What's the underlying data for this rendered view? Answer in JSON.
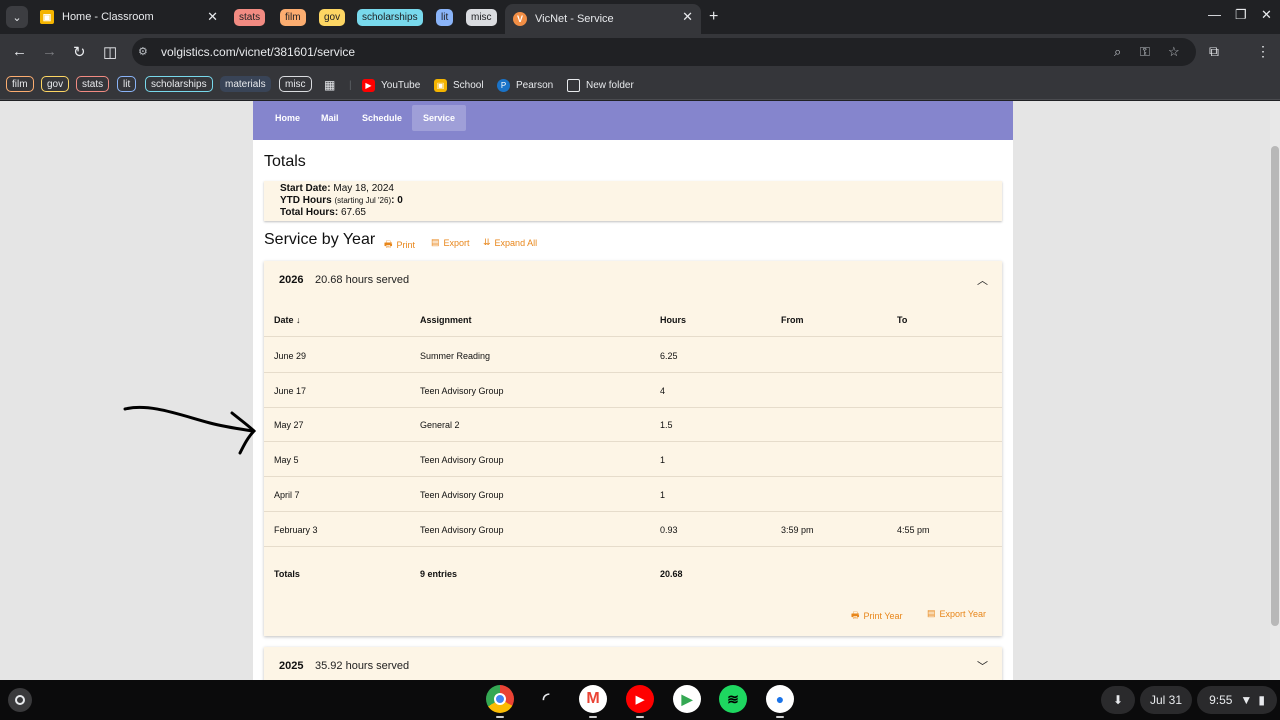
{
  "browser": {
    "tabs": [
      {
        "title": "Home - Classroom",
        "active": false
      },
      {
        "title": "VicNet - Service",
        "active": true
      }
    ],
    "tab_groups": [
      {
        "label": "stats",
        "color": "#f28b82"
      },
      {
        "label": "film",
        "color": "#fcad70"
      },
      {
        "label": "gov",
        "color": "#fdd663"
      },
      {
        "label": "scholarships",
        "color": "#78d9ec"
      },
      {
        "label": "lit",
        "color": "#8ab4f8"
      },
      {
        "label": "misc",
        "color": "#dadce0"
      }
    ],
    "url": "volgistics.com/vicnet/381601/service",
    "bookmark_groups": [
      {
        "label": "film",
        "color": "#fcad70"
      },
      {
        "label": "gov",
        "color": "#fdd663"
      },
      {
        "label": "stats",
        "color": "#f28b82"
      },
      {
        "label": "lit",
        "color": "#8ab4f8"
      },
      {
        "label": "scholarships",
        "color": "#78d9ec"
      },
      {
        "label": "materials",
        "color": "#aecbfa"
      },
      {
        "label": "misc",
        "color": "#dadce0"
      }
    ],
    "bookmarks": [
      {
        "label": "YouTube",
        "icon": "youtube-icon"
      },
      {
        "label": "School",
        "icon": "classroom-icon"
      },
      {
        "label": "Pearson",
        "icon": "pearson-icon"
      },
      {
        "label": "New folder",
        "icon": "folder-icon"
      }
    ]
  },
  "nav": {
    "items": [
      "Home",
      "Mail",
      "Schedule",
      "Service"
    ],
    "active": "Service",
    "color": "#8585cd"
  },
  "totals": {
    "title": "Totals",
    "start_date_label": "Start Date:",
    "start_date": "May 18, 2024",
    "ytd_label": "YTD Hours",
    "ytd_note": "(starting Jul '26)",
    "ytd_value": ": 0",
    "total_label": "Total Hours:",
    "total_value": "67.65"
  },
  "service": {
    "title": "Service by Year",
    "actions": {
      "print": "Print",
      "export": "Export",
      "expand": "Expand All"
    },
    "accent": "#e8861a",
    "years": [
      {
        "year": "2026",
        "hours_text": "20.68 hours served",
        "expanded": true,
        "columns": [
          "Date",
          "Assignment",
          "Hours",
          "From",
          "To"
        ],
        "rows": [
          {
            "date": "June 29",
            "assignment": "Summer Reading",
            "hours": "6.25",
            "from": "",
            "to": ""
          },
          {
            "date": "June 17",
            "assignment": "Teen Advisory Group",
            "hours": "4",
            "from": "",
            "to": ""
          },
          {
            "date": "May 27",
            "assignment": "General 2",
            "hours": "1.5",
            "from": "",
            "to": ""
          },
          {
            "date": "May 5",
            "assignment": "Teen Advisory Group",
            "hours": "1",
            "from": "",
            "to": ""
          },
          {
            "date": "April 7",
            "assignment": "Teen Advisory Group",
            "hours": "1",
            "from": "",
            "to": ""
          },
          {
            "date": "February 3",
            "assignment": "Teen Advisory Group",
            "hours": "0.93",
            "from": "3:59 pm",
            "to": "4:55 pm"
          }
        ],
        "totals": {
          "label": "Totals",
          "entries": "9 entries",
          "hours": "20.68"
        },
        "print_year": "Print Year",
        "export_year": "Export Year"
      },
      {
        "year": "2025",
        "hours_text": "35.92 hours served",
        "expanded": false
      }
    ]
  },
  "shelf": {
    "apps": [
      "chrome-icon",
      "cast-icon",
      "gmail-icon",
      "youtube-icon",
      "play-store-icon",
      "spotify-icon",
      "messages-icon"
    ],
    "date": "Jul 31",
    "time": "9:55"
  }
}
